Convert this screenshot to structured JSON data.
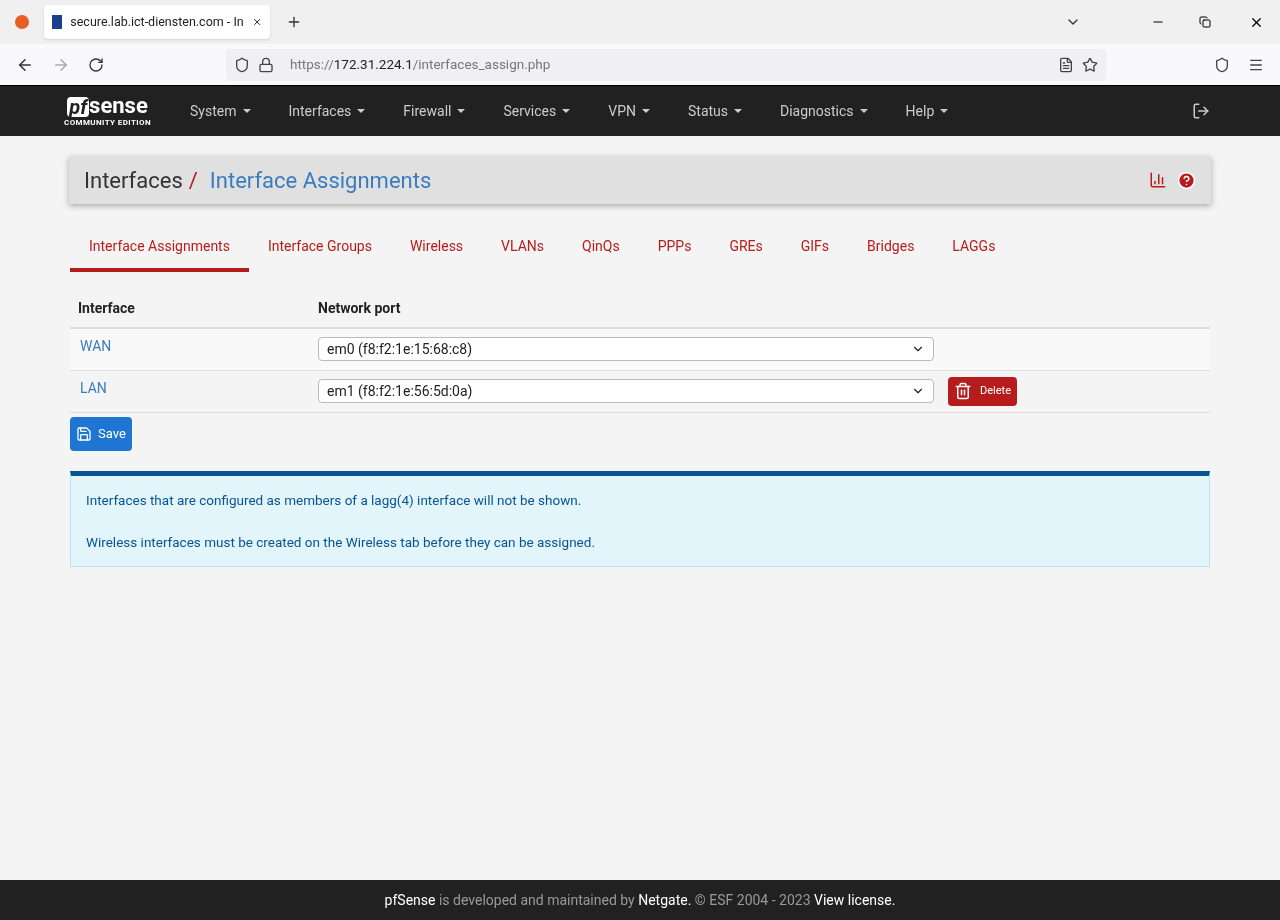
{
  "browser": {
    "tab_title": "secure.lab.ict-diensten.com - In",
    "url": {
      "scheme": "https://",
      "host": "172.31.224.1",
      "path": "/interfaces_assign.php"
    }
  },
  "logo": {
    "brand_a": "pf",
    "brand_b": "sense",
    "edition": "COMMUNITY EDITION"
  },
  "nav": [
    "System",
    "Interfaces",
    "Firewall",
    "Services",
    "VPN",
    "Status",
    "Diagnostics",
    "Help"
  ],
  "breadcrumb": {
    "parent": "Interfaces",
    "separator": "/",
    "current": "Interface Assignments"
  },
  "tabs": [
    {
      "label": "Interface Assignments",
      "selected": true
    },
    {
      "label": "Interface Groups",
      "selected": false
    },
    {
      "label": "Wireless",
      "selected": false
    },
    {
      "label": "VLANs",
      "selected": false
    },
    {
      "label": "QinQs",
      "selected": false
    },
    {
      "label": "PPPs",
      "selected": false
    },
    {
      "label": "GREs",
      "selected": false
    },
    {
      "label": "GIFs",
      "selected": false
    },
    {
      "label": "Bridges",
      "selected": false
    },
    {
      "label": "LAGGs",
      "selected": false
    }
  ],
  "table": {
    "columns": [
      "Interface",
      "Network port"
    ],
    "rows": [
      {
        "interface": "WAN",
        "port": "em0 (f8:f2:1e:15:68:c8)"
      },
      {
        "interface": "LAN",
        "port": "em1 (f8:f2:1e:56:5d:0a)",
        "delete_label": "Delete"
      }
    ]
  },
  "save_label": "Save",
  "notes": [
    "Interfaces that are configured as members of a lagg(4) interface will not be shown.",
    "Wireless interfaces must be created on the Wireless tab before they can be assigned."
  ],
  "footer": [
    {
      "text": "pfSense",
      "kind": "strong"
    },
    {
      "text": " is developed and maintained by ",
      "kind": "plain"
    },
    {
      "text": "Netgate.",
      "kind": "link"
    },
    {
      "text": " © ESF 2004 - 2023 ",
      "kind": "plain"
    },
    {
      "text": "View license.",
      "kind": "link"
    }
  ]
}
